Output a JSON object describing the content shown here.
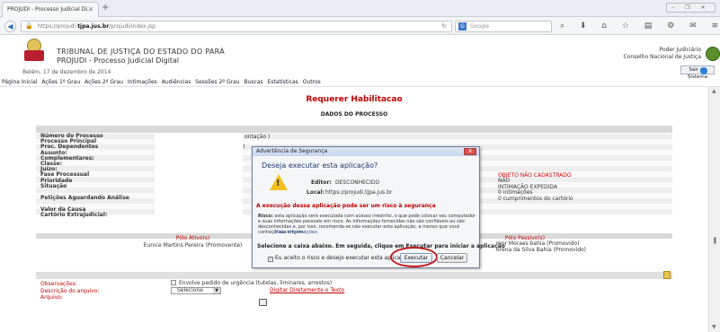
{
  "browser": {
    "tab_title": "PROJUDI - Processo Judicial Di...",
    "tab_close": "×",
    "new_tab": "+",
    "url_prefix": "https://projudi.",
    "url_domain": "tjpa.jus.br",
    "url_suffix": "/projudi/index.jsp",
    "search_placeholder": "Google",
    "search_engine": "G",
    "toolbar_icons": "⌕ ⬇ ⌂ ☆ ▤ ⚙ ✉ ≡",
    "window_buttons": "– ❐ ✕"
  },
  "header": {
    "court": "TRIBUNAL DE JUSTIÇA DO ESTADO DO PARÁ",
    "system": "PROJUDI - Processo Judicial Digital",
    "date": "Belém, 17 de dezembro de 2014",
    "pj": "Poder Judiciário",
    "cnj": "Conselho Nacional de Justiça",
    "logout": "Sair do Sistema"
  },
  "menu": [
    "Página Inicial",
    "Ações 1º Grau",
    "Ações 2º Grau",
    "Intimações",
    "Audiências",
    "Sessões 2º Grau",
    "Buscas",
    "Estatísticas",
    "Outros"
  ],
  "page": {
    "title": "Requerer Habilitacao",
    "subtitle": "DADOS DO PROCESSO"
  },
  "fields": [
    "Número do Processo",
    "Processo Principal",
    "Proc. Dependentes",
    "Assunto:",
    "Complementares:",
    "Classe:",
    "Juízo:",
    "Fase Processual",
    "Prioridade",
    "Situação",
    "",
    "Petições Aguardando Análise",
    "",
    "Valor da Causa",
    "Cartório Extrajudicial:"
  ],
  "fragments": {
    "f1": "ontação )",
    "f2": ")"
  },
  "right_values": [
    "OBJETO NÃO CADASTRADO",
    "NÃO",
    "INTIMAÇÃO EXPEDIDA",
    "0 intimações",
    "0 cumprimentos do cartório"
  ],
  "polos": {
    "ativo_header": "Pólo Ativo(s)",
    "passivo_header": "Pólo Passivo(s)",
    "ativo": "Eunice Martins Pereira (Promovente)",
    "passivo1": "mor Moraes bahia (Promovido)",
    "passivo2": "orena da Silva Bahia (Promovido)"
  },
  "form": {
    "obs_label": "Observações:",
    "desc_label": "Descrição do arquivo:",
    "arq_label": "Arquivo:",
    "urgency": "Envolve pedido de urgência (tutelas, liminares, arrestos)",
    "select_value": "Selecione",
    "digitar": "Digitar Diretamente o Texto"
  },
  "dialog": {
    "title": "Advertência de Segurança",
    "close": "X",
    "question": "Deseja executar esta aplicação?",
    "editor_label": "Editor:",
    "editor_value": "DESCONHECIDO",
    "local_label": "Local:",
    "local_value": "https://projudi.tjpa.jus.br",
    "risk_heading": "A execução dessa aplicação pode ser um risco à segurança",
    "risk_label": "Risco:",
    "risk_text": "esta aplicação será executada com acesso irrestrito, o que pode colocar seu computador e suas informações pessoais em risco. As informações fornecidas não são confiáveis ou são desconhecidas e, por isso, recomenda-se não executar esta aplicação, a menos que você conheça sua origem",
    "more_info": "Mais Informações",
    "select_text": "Selecione a caixa abaixo. Em seguida, clique em Executar para iniciar a aplicação",
    "checkbox": "Eu aceito o risco e desejo executar esta aplicação.",
    "run": "Executar",
    "cancel": "Cancelar"
  }
}
